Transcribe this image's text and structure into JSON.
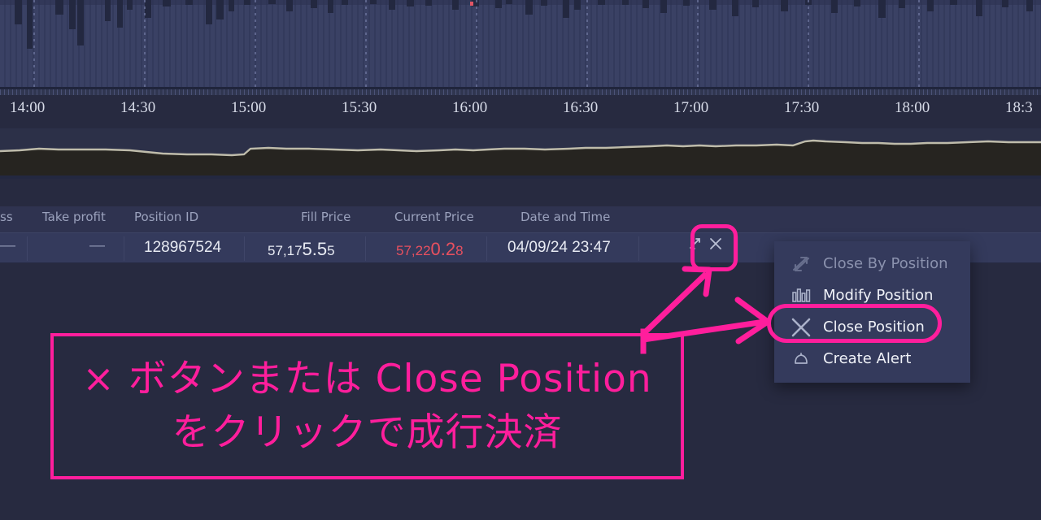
{
  "chart": {
    "time_axis_labels": [
      "14:00",
      "14:30",
      "15:00",
      "15:30",
      "16:00",
      "16:30",
      "17:00",
      "17:30",
      "18:00",
      "18:3"
    ],
    "panel_bg": "#333a5c",
    "axis_bg": "#272a40",
    "navigator_line_color": "#b9b6a5",
    "navigator_fill_color": "#26241f"
  },
  "table": {
    "columns": [
      {
        "label": "ss",
        "align": "left"
      },
      {
        "label": "Take profit",
        "align": "right"
      },
      {
        "label": "Position ID",
        "align": "left"
      },
      {
        "label": "Fill Price",
        "align": "right"
      },
      {
        "label": "Current Price",
        "align": "right"
      },
      {
        "label": "Date and Time",
        "align": "left"
      }
    ],
    "row": {
      "stop_loss": "—",
      "take_profit": "—",
      "position_id": "128967524",
      "fill_price": {
        "prefix": "57,17",
        "mid": "5.5",
        "suffix": "5"
      },
      "current_price": {
        "prefix": "57,22",
        "mid": "0.2",
        "suffix": "8"
      },
      "current_price_color": "#e8505f",
      "date_and_time": "04/09/24 23:47",
      "partial_icon": "swap-icon",
      "close_icon": "close-x-icon"
    }
  },
  "context_menu": {
    "items": [
      {
        "label": "Close By Position",
        "icon": "two-arrows-icon",
        "disabled": true
      },
      {
        "label": "Modify Position",
        "icon": "bars-icon",
        "disabled": false
      },
      {
        "label": "Close Position",
        "icon": "x-icon",
        "disabled": false,
        "highlighted": true
      },
      {
        "label": "Create Alert",
        "icon": "bell-icon",
        "disabled": false
      }
    ]
  },
  "annotation": {
    "accent_color": "#ff1e9c",
    "callout_line_1": "× ボタンまたは Close Position",
    "callout_line_2": "をクリックで成行決済",
    "arrow_to_close_button": "arrow-up-right",
    "arrow_to_menu_item": "arrow-right"
  }
}
